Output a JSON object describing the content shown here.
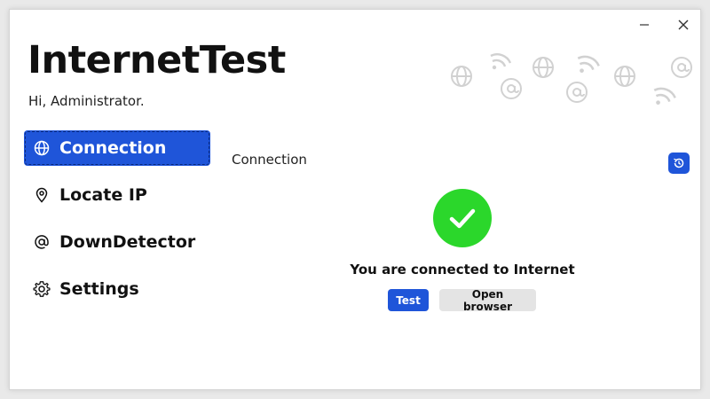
{
  "window": {
    "minimize_icon": "minimize-icon",
    "close_icon": "close-icon"
  },
  "app": {
    "title": "InternetTest",
    "greeting": "Hi, Administrator."
  },
  "nav": {
    "items": [
      {
        "label": "Connection",
        "icon": "globe-icon",
        "active": true
      },
      {
        "label": "Locate IP",
        "icon": "map-pin-icon",
        "active": false
      },
      {
        "label": "DownDetector",
        "icon": "at-icon",
        "active": false
      },
      {
        "label": "Settings",
        "icon": "gear-icon",
        "active": false
      }
    ]
  },
  "main": {
    "section_title": "Connection",
    "history_icon": "history-icon",
    "status_icon": "check-icon",
    "status_text": "You are connected to Internet",
    "test_label": "Test",
    "open_browser_label": "Open browser"
  },
  "colors": {
    "accent": "#1f55d9",
    "success": "#2bd72b"
  }
}
